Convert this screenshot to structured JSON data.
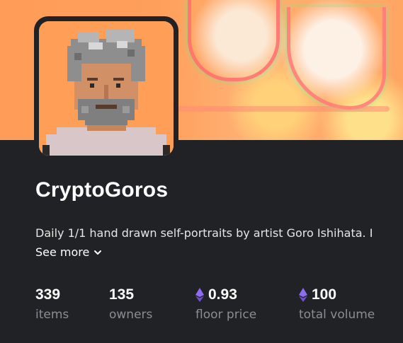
{
  "collection": {
    "name": "CryptoGoros",
    "description": "Daily 1/1 hand drawn self-portraits by artist Goro Ishihata. I",
    "see_more_label": "See more"
  },
  "stats": [
    {
      "value": "339",
      "label": "items",
      "currency_icon": ""
    },
    {
      "value": "135",
      "label": "owners",
      "currency_icon": ""
    },
    {
      "value": "0.93",
      "label": "floor price",
      "currency_icon": "ethereum-icon"
    },
    {
      "value": "100",
      "label": "total volume",
      "currency_icon": "ethereum-icon"
    }
  ],
  "colors": {
    "background": "#202225",
    "avatar_background": "#ff9f57",
    "label_gray": "#8a8d92",
    "eth_purple": "#8e6cf0"
  }
}
